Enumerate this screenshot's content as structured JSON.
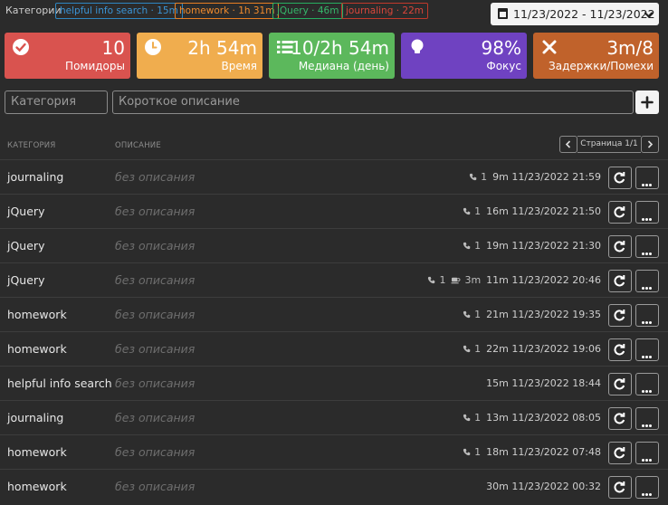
{
  "filters": {
    "label": "Категории",
    "chips": [
      {
        "text": "helpful info search · 15m",
        "color": "#2e86c1"
      },
      {
        "text": "homework · 1h 31m",
        "color": "#e67e22"
      },
      {
        "text": "jQuery · 46m",
        "color": "#27ae60"
      },
      {
        "text": "journaling · 22m",
        "color": "#c0392b"
      }
    ]
  },
  "date_range": {
    "label": "11/23/2022 - 11/23/2022"
  },
  "stats": [
    {
      "value": "10",
      "label": "Помидоры",
      "color": "#d9534f",
      "icon": "check-circle-icon"
    },
    {
      "value": "2h 54m",
      "label": "Время",
      "color": "#f0ad4e",
      "icon": "clock-icon"
    },
    {
      "value": "10/2h 54m",
      "label": "Медиана (день)",
      "color": "#5cb85c",
      "icon": "list-icon"
    },
    {
      "value": "98%",
      "label": "Фокус",
      "color": "#6f42c1",
      "icon": "lightbulb-icon"
    },
    {
      "value": "3m/8",
      "label": "Задержки/Помехи",
      "color": "#c0622b",
      "icon": "close-icon"
    }
  ],
  "form": {
    "category_placeholder": "Категория",
    "description_placeholder": "Короткое описание"
  },
  "table": {
    "col_category": "КАТЕГОРИЯ",
    "col_description": "ОПИСАНИЕ",
    "pager_label": "Страница 1/1",
    "rows": [
      {
        "category": "journaling",
        "description": "без описания",
        "calls": "1",
        "pause": "",
        "duration": "9m",
        "timestamp": "11/23/2022 21:59"
      },
      {
        "category": "jQuery",
        "description": "без описания",
        "calls": "1",
        "pause": "",
        "duration": "16m",
        "timestamp": "11/23/2022 21:50"
      },
      {
        "category": "jQuery",
        "description": "без описания",
        "calls": "1",
        "pause": "",
        "duration": "19m",
        "timestamp": "11/23/2022 21:30"
      },
      {
        "category": "jQuery",
        "description": "без описания",
        "calls": "1",
        "pause": "3m",
        "duration": "11m",
        "timestamp": "11/23/2022 20:46"
      },
      {
        "category": "homework",
        "description": "без описания",
        "calls": "1",
        "pause": "",
        "duration": "21m",
        "timestamp": "11/23/2022 19:35"
      },
      {
        "category": "homework",
        "description": "без описания",
        "calls": "1",
        "pause": "",
        "duration": "22m",
        "timestamp": "11/23/2022 19:06"
      },
      {
        "category": "helpful info search",
        "description": "без описания",
        "calls": "",
        "pause": "",
        "duration": "15m",
        "timestamp": "11/23/2022 18:44"
      },
      {
        "category": "journaling",
        "description": "без описания",
        "calls": "1",
        "pause": "",
        "duration": "13m",
        "timestamp": "11/23/2022 08:05"
      },
      {
        "category": "homework",
        "description": "без описания",
        "calls": "1",
        "pause": "",
        "duration": "18m",
        "timestamp": "11/23/2022 07:48"
      },
      {
        "category": "homework",
        "description": "без описания",
        "calls": "",
        "pause": "",
        "duration": "30m",
        "timestamp": "11/23/2022 00:32"
      }
    ]
  }
}
